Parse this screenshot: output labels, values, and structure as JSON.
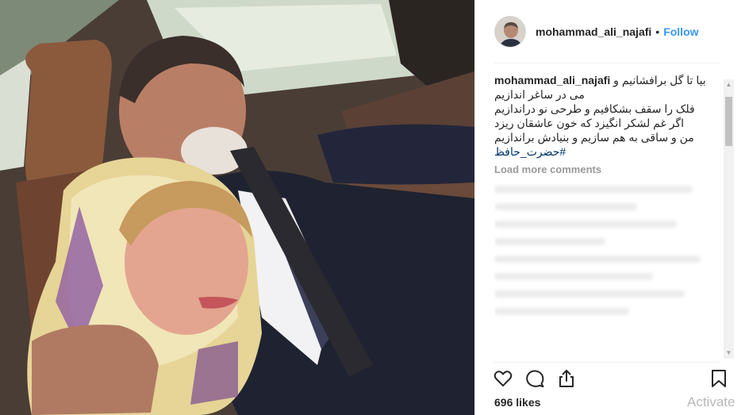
{
  "post": {
    "header": {
      "username": "mohammad_ali_najafi",
      "separator": "•",
      "follow_label": "Follow"
    },
    "caption": {
      "username": "mohammad_ali_najafi",
      "lines": [
        "بیا تا گل برافشانیم و",
        "می در ساغر اندازیم",
        "فلک را سقف بشکافیم و طرحی نو دراندازیم",
        "اگر غم لشکر انگیزد که خون عاشقان ریزد",
        "من و ساقی به هم سازیم و بنیادش براندازیم"
      ],
      "hashtag": "#حضرت_حافظ"
    },
    "load_more_label": "Load more comments",
    "likes_label": "696 likes",
    "icons": {
      "like": "heart-icon",
      "comment": "comment-icon",
      "share": "share-icon",
      "save": "bookmark-icon"
    },
    "photo": {
      "description_icon": "post-photo"
    }
  },
  "os": {
    "watermark": "Activate"
  },
  "colors": {
    "accent": "#3897f0",
    "text": "#262626",
    "muted": "#999999",
    "border": "#efefef"
  }
}
